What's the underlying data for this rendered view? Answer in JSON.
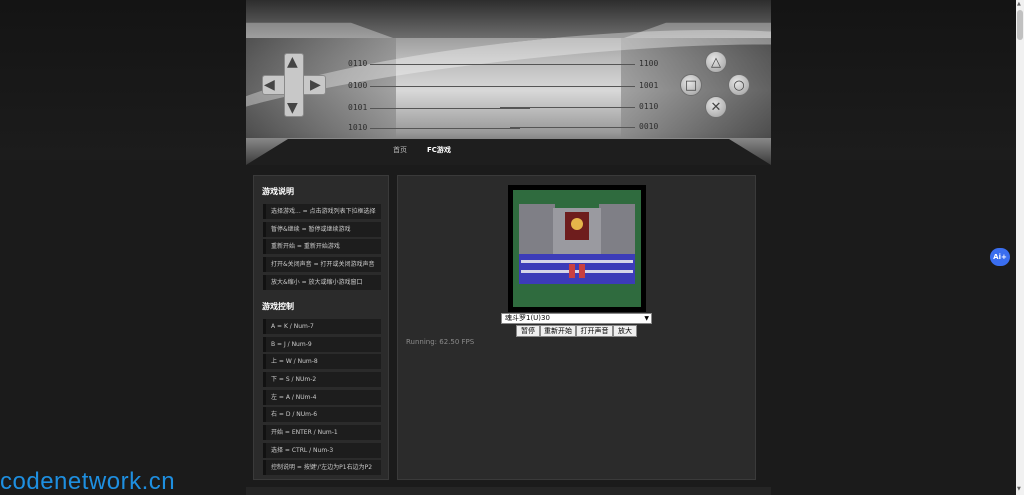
{
  "header": {
    "nav": [
      {
        "label": "首页",
        "active": false
      },
      {
        "label": "FC游戏",
        "active": true
      }
    ],
    "binary_left": [
      "0110",
      "0100",
      "0101",
      "1010"
    ],
    "binary_right": [
      "1100",
      "1001",
      "0110",
      "0010"
    ],
    "dpad_icons": [
      "arrow-up-icon",
      "arrow-down-icon",
      "arrow-left-icon",
      "arrow-right-icon"
    ],
    "face_buttons": {
      "triangle": "△",
      "square": "□",
      "circle": "○",
      "cross": "✕"
    }
  },
  "sidebar": {
    "instructions_title": "游戏说明",
    "instructions": [
      "选择游戏... = 点击游戏列表下拉框选择",
      "暂停&继续 = 暂停或继续游戏",
      "重新开始 = 重新开始游戏",
      "打开&关闭声音 = 打开或关闭游戏声音",
      "放大&缩小 = 放大或缩小游戏窗口"
    ],
    "controls_title": "游戏控制",
    "controls": [
      "A = K / Num-7",
      "B = J / Num-9",
      "上 = W / Num-8",
      "下 = S / NUm-2",
      "左 = A / NUm-4",
      "右 = D / NUm-6",
      "开始 = ENTER / Num-1",
      "选择 = CTRL / Num-3",
      "控制说明 = 按键'/'左边为P1右边为P2"
    ]
  },
  "emulator": {
    "selected_game": "魂斗罗1(U)30",
    "buttons": [
      "暂停",
      "重新开始",
      "打开声音",
      "放大"
    ],
    "status": "Running: 62.50 FPS"
  },
  "badge": {
    "label": "Ai+"
  },
  "watermark": "codenetwork.cn",
  "colors": {
    "accent": "#3a6ef0",
    "watermark": "#1e8fe0",
    "panel": "#2b2b2b"
  }
}
